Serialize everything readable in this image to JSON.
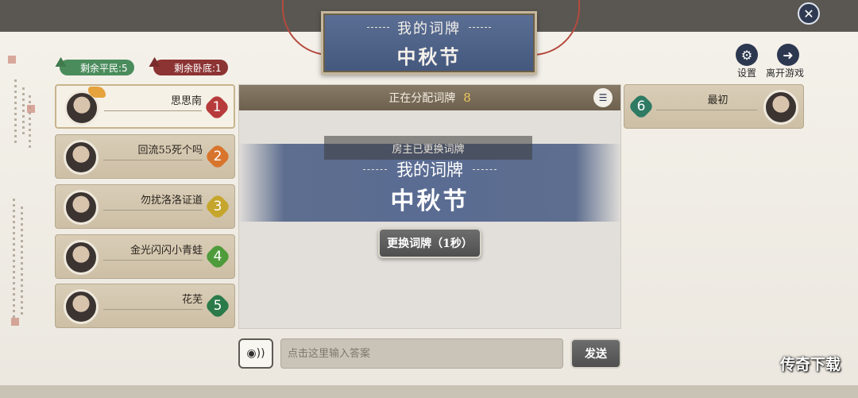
{
  "title": {
    "subtitle": "我的词牌",
    "main": "中秋节"
  },
  "counters": {
    "civilians": "剩余平民:5",
    "spies": "剩余卧底:1"
  },
  "top_right": {
    "settings_label": "设置",
    "leave_label": "离开游戏"
  },
  "players_left": [
    {
      "name": "思思南",
      "number": "1",
      "color": "#b73b3b"
    },
    {
      "name": "回流55死个吗",
      "number": "2",
      "color": "#d8752d"
    },
    {
      "name": "勿扰洛洛证道",
      "number": "3",
      "color": "#c5a52c"
    },
    {
      "name": "金光闪闪小青蛙",
      "number": "4",
      "color": "#4e9b3b"
    },
    {
      "name": "花芜",
      "number": "5",
      "color": "#2b7a4a"
    }
  ],
  "players_right": [
    {
      "name": "最初",
      "number": "6",
      "color": "#2e7a63"
    }
  ],
  "center": {
    "status_label": "正在分配词牌",
    "countdown": "8",
    "notice": "房主已更换词牌",
    "card_subtitle": "我的词牌",
    "card_main": "中秋节",
    "change_button": "更换词牌（1秒）"
  },
  "input": {
    "placeholder": "点击这里输入答案",
    "send_label": "发送"
  },
  "icons": {
    "close": "close-icon",
    "settings": "gear-icon",
    "leave": "exit-icon",
    "voice": "voice-icon",
    "list": "list-icon"
  },
  "watermark": "传奇下载"
}
